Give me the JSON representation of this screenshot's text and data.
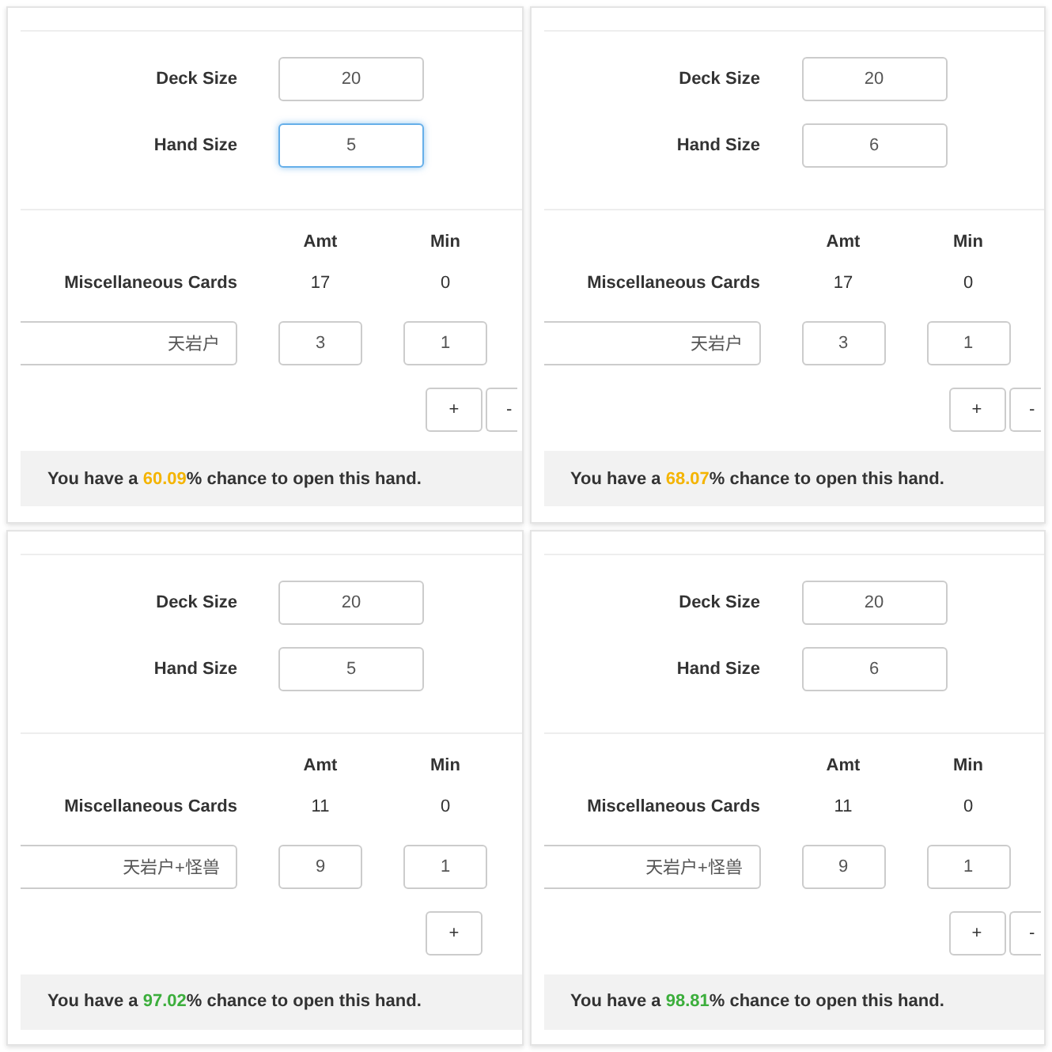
{
  "panels": [
    {
      "fields": [
        {
          "label": "Deck Size",
          "value": "20",
          "focused": false
        },
        {
          "label": "Hand Size",
          "value": "5",
          "focused": true
        }
      ],
      "columns": [
        "Amt",
        "Min"
      ],
      "misc": {
        "label": "Miscellaneous Cards",
        "amt": "17",
        "min": "0"
      },
      "cards": [
        {
          "name": "天岩户",
          "amt": "3",
          "min": "1"
        }
      ],
      "buttons": [
        {
          "label": "+",
          "cut": false
        },
        {
          "label": "-",
          "cut": true
        }
      ],
      "result": {
        "prefix": "You have a ",
        "percent": "60.09",
        "suffix": "% chance to open this hand.",
        "color": "#f4b400"
      }
    },
    {
      "fields": [
        {
          "label": "Deck Size",
          "value": "20",
          "focused": false
        },
        {
          "label": "Hand Size",
          "value": "6",
          "focused": false
        }
      ],
      "columns": [
        "Amt",
        "Min"
      ],
      "misc": {
        "label": "Miscellaneous Cards",
        "amt": "17",
        "min": "0"
      },
      "cards": [
        {
          "name": "天岩户",
          "amt": "3",
          "min": "1"
        }
      ],
      "buttons": [
        {
          "label": "+",
          "cut": false
        },
        {
          "label": "-",
          "cut": true
        }
      ],
      "result": {
        "prefix": "You have a ",
        "percent": "68.07",
        "suffix": "% chance to open this hand.",
        "color": "#f4b400"
      }
    },
    {
      "fields": [
        {
          "label": "Deck Size",
          "value": "20",
          "focused": false
        },
        {
          "label": "Hand Size",
          "value": "5",
          "focused": false
        }
      ],
      "columns": [
        "Amt",
        "Min"
      ],
      "misc": {
        "label": "Miscellaneous Cards",
        "amt": "11",
        "min": "0"
      },
      "cards": [
        {
          "name": "天岩户+怪兽",
          "amt": "9",
          "min": "1"
        }
      ],
      "buttons": [
        {
          "label": "+",
          "cut": false
        }
      ],
      "result": {
        "prefix": "You have a ",
        "percent": "97.02",
        "suffix": "% chance to open this hand.",
        "color": "#3cae3c"
      }
    },
    {
      "fields": [
        {
          "label": "Deck Size",
          "value": "20",
          "focused": false
        },
        {
          "label": "Hand Size",
          "value": "6",
          "focused": false
        }
      ],
      "columns": [
        "Amt",
        "Min"
      ],
      "misc": {
        "label": "Miscellaneous Cards",
        "amt": "11",
        "min": "0"
      },
      "cards": [
        {
          "name": "天岩户+怪兽",
          "amt": "9",
          "min": "1"
        }
      ],
      "buttons": [
        {
          "label": "+",
          "cut": false
        },
        {
          "label": "-",
          "cut": true
        }
      ],
      "result": {
        "prefix": "You have a ",
        "percent": "98.81",
        "suffix": "% chance to open this hand.",
        "color": "#3cae3c"
      }
    }
  ]
}
